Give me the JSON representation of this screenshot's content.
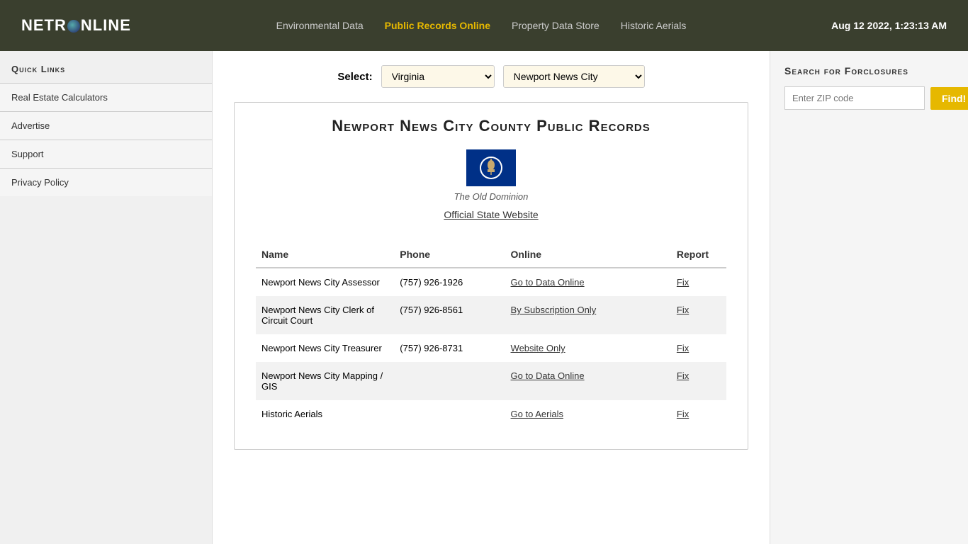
{
  "header": {
    "logo_text_start": "NETR",
    "logo_text_end": "NLINE",
    "nav_items": [
      {
        "label": "Environmental Data",
        "active": false
      },
      {
        "label": "Public Records Online",
        "active": true
      },
      {
        "label": "Property Data Store",
        "active": false
      },
      {
        "label": "Historic Aerials",
        "active": false
      }
    ],
    "datetime": "Aug 12 2022, 1:23:13 AM"
  },
  "sidebar": {
    "title": "Quick Links",
    "items": [
      {
        "label": "Real Estate Calculators"
      },
      {
        "label": "Advertise"
      },
      {
        "label": "Support"
      },
      {
        "label": "Privacy Policy"
      }
    ]
  },
  "select_bar": {
    "label": "Select:",
    "state_selected": "Virginia",
    "county_selected": "Newport News City",
    "states": [
      "Virginia"
    ],
    "counties": [
      "Newport News City"
    ]
  },
  "content": {
    "heading": "Newport News City County Public Records",
    "flag_caption": "The Old Dominion",
    "official_link_text": "Official State Website",
    "table": {
      "columns": [
        "Name",
        "Phone",
        "Online",
        "Report"
      ],
      "rows": [
        {
          "name": "Newport News City Assessor",
          "phone": "(757) 926-1926",
          "online_text": "Go to Data Online",
          "online_href": "#",
          "report_text": "Fix",
          "report_href": "#",
          "shaded": false
        },
        {
          "name": "Newport News City Clerk of Circuit Court",
          "phone": "(757) 926-8561",
          "online_text": "By Subscription Only",
          "online_href": "#",
          "report_text": "Fix",
          "report_href": "#",
          "shaded": true
        },
        {
          "name": "Newport News City Treasurer",
          "phone": "(757) 926-8731",
          "online_text": "Website Only",
          "online_href": "#",
          "report_text": "Fix",
          "report_href": "#",
          "shaded": false
        },
        {
          "name": "Newport News City Mapping / GIS",
          "phone": "",
          "online_text": "Go to Data Online",
          "online_href": "#",
          "report_text": "Fix",
          "report_href": "#",
          "shaded": true
        },
        {
          "name": "Historic Aerials",
          "phone": "",
          "online_text": "Go to Aerials",
          "online_href": "#",
          "report_text": "Fix",
          "report_href": "#",
          "shaded": false
        }
      ]
    }
  },
  "right_panel": {
    "title": "Search for Forclosures",
    "zip_placeholder": "Enter ZIP code",
    "find_label": "Find!"
  }
}
